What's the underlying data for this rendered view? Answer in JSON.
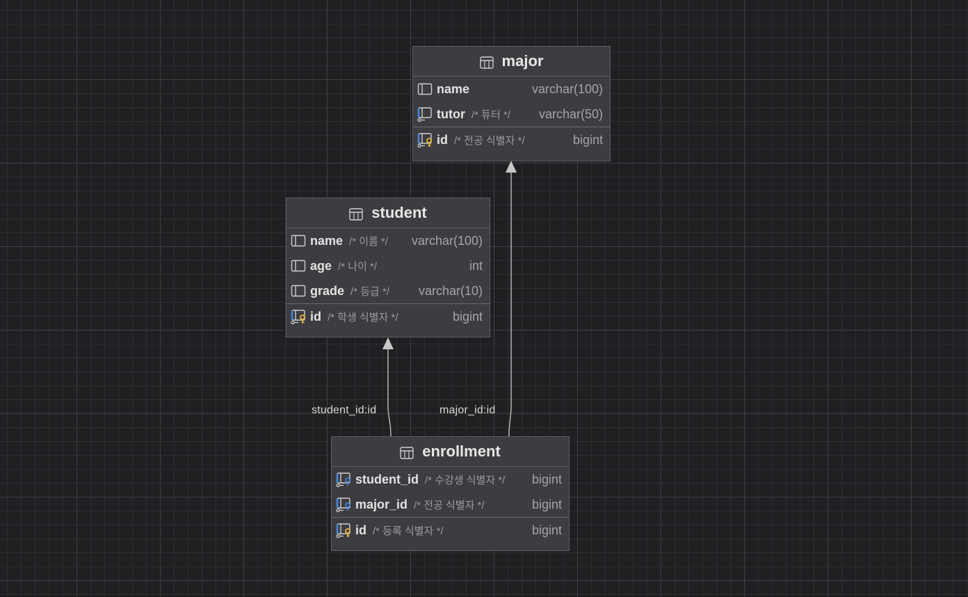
{
  "tables": {
    "major": {
      "title": "major",
      "columns": [
        {
          "name": "name",
          "comment": "",
          "type": "varchar(100)"
        },
        {
          "name": "tutor",
          "comment": "/* 튜터 */",
          "type": "varchar(50)"
        }
      ],
      "keys": [
        {
          "name": "id",
          "comment": "/* 전공 식별자 */",
          "type": "bigint"
        }
      ]
    },
    "student": {
      "title": "student",
      "columns": [
        {
          "name": "name",
          "comment": "/* 이름 */",
          "type": "varchar(100)"
        },
        {
          "name": "age",
          "comment": "/* 나이 */",
          "type": "int"
        },
        {
          "name": "grade",
          "comment": "/* 등급 */",
          "type": "varchar(10)"
        }
      ],
      "keys": [
        {
          "name": "id",
          "comment": "/* 학생 식별자 */",
          "type": "bigint"
        }
      ]
    },
    "enrollment": {
      "title": "enrollment",
      "columns": [
        {
          "name": "student_id",
          "comment": "/* 수강생 식별자 */",
          "type": "bigint"
        },
        {
          "name": "major_id",
          "comment": "/* 전공 식별자 */",
          "type": "bigint"
        }
      ],
      "keys": [
        {
          "name": "id",
          "comment": "/* 등록 식별자 */",
          "type": "bigint"
        }
      ]
    }
  },
  "relations": {
    "student_fk": {
      "label": "student_id:id",
      "from": "enrollment",
      "to": "student"
    },
    "major_fk": {
      "label": "major_id:id",
      "from": "enrollment",
      "to": "major"
    }
  },
  "colors": {
    "canvas": "#1f2022",
    "table_bg": "#3c3d40",
    "foreign_key_icon": "#4a88e8",
    "primary_key_icon": "#e8b43a",
    "edge": "#bfbfbf"
  },
  "icons": {
    "table": "table-icon",
    "column": "column-icon",
    "foreign_key": "foreign-key-column-icon",
    "primary_key": "primary-key-column-icon"
  }
}
